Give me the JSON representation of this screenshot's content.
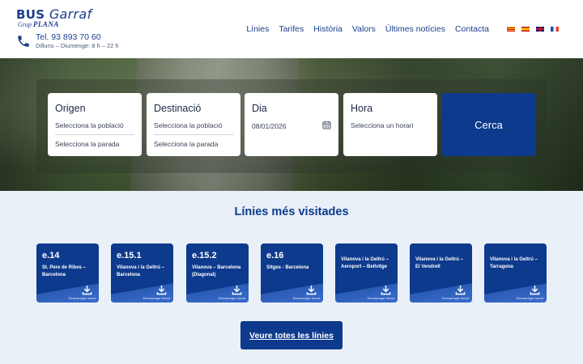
{
  "logo": {
    "main": "BUS",
    "sub_word": "Garraf",
    "tagline_prefix": "Grup",
    "tagline_name": "PLANA"
  },
  "contact": {
    "phone": "Tel. 93 893 70 60",
    "hours": "Dilluns – Diumenge: 8 h – 22 h",
    "icon": "phone-icon"
  },
  "nav": {
    "items": [
      "Línies",
      "Tarifes",
      "Història",
      "Valors",
      "Últimes notícies",
      "Contacta"
    ],
    "languages": [
      "ca-flag",
      "es-flag",
      "en-flag",
      "fr-flag"
    ]
  },
  "search": {
    "origin": {
      "title": "Origen",
      "select_town": "Selecciona la població",
      "select_stop": "Selecciona la parada"
    },
    "destination": {
      "title": "Destinació",
      "select_town": "Selecciona la població",
      "select_stop": "Selecciona la parada"
    },
    "day": {
      "title": "Dia",
      "value": "08/01/2026",
      "icon": "calendar-icon"
    },
    "time": {
      "title": "Hora",
      "select": "Selecciona un horari"
    },
    "button": "Cerca"
  },
  "lines": {
    "title": "Línies més visitades",
    "download_label": "Descarregar horari",
    "cards": [
      {
        "code": "e.14",
        "route": "St. Pere de Ribes – Barcelona"
      },
      {
        "code": "e.15.1",
        "route": "Vilanova i la Geltrú – Barcelona"
      },
      {
        "code": "e.15.2",
        "route": "Vilanova – Barcelona (Diagonal)"
      },
      {
        "code": "e.16",
        "route": "Sitges - Barcelona"
      },
      {
        "code": "",
        "route": "Vilanova i la Geltrú – Aeroport – Bellvitge"
      },
      {
        "code": "",
        "route": "Vilanova i la Geltrú – El Vendrell"
      },
      {
        "code": "",
        "route": "Vilanova i la Geltrú – Tarragona"
      }
    ],
    "all_button": "Veure totes les línies"
  },
  "colors": {
    "brand": "#0d3a8c",
    "background": "#e9f0f8",
    "header": "#ffffff"
  }
}
